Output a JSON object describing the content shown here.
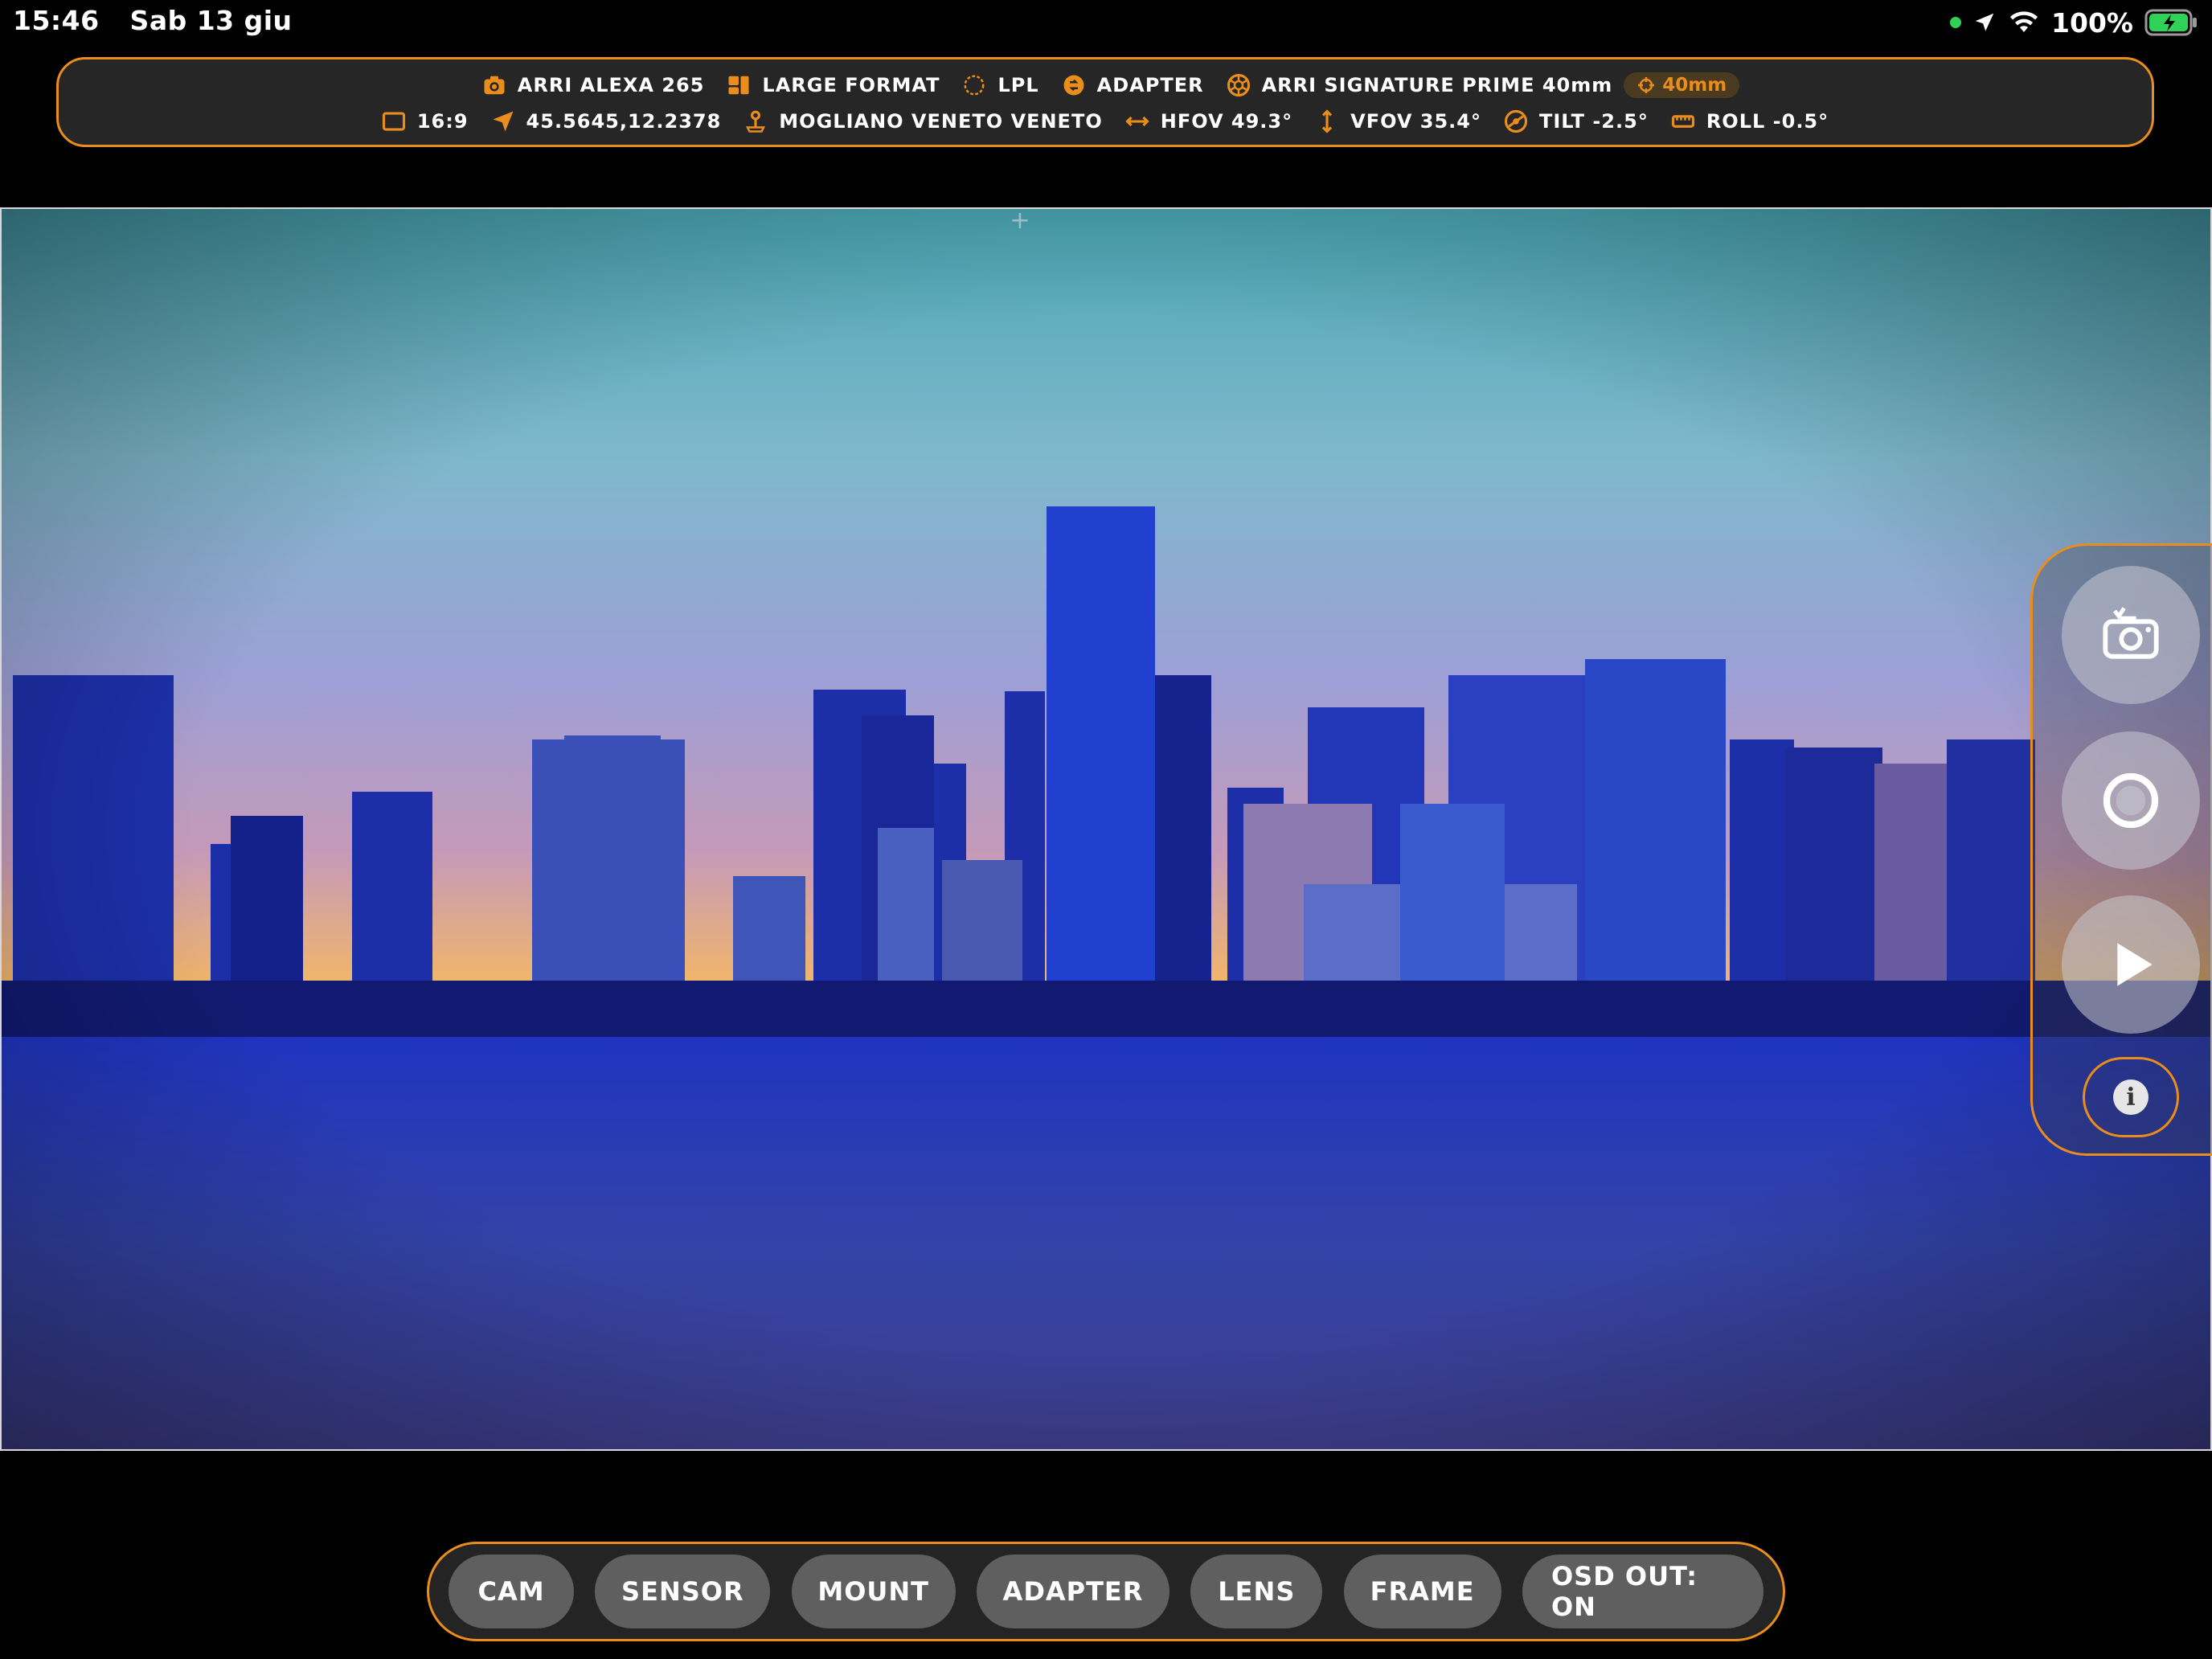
{
  "status_bar": {
    "time": "15:46",
    "date": "Sab 13 giu",
    "battery": "100%"
  },
  "info_bar": {
    "row1": [
      {
        "icon": "camera-icon",
        "label": "ARRI ALEXA 265"
      },
      {
        "icon": "sensor-icon",
        "label": "LARGE FORMAT"
      },
      {
        "icon": "mount-icon",
        "label": "LPL"
      },
      {
        "icon": "adapter-icon",
        "label": "ADAPTER"
      },
      {
        "icon": "lens-icon",
        "label": "ARRI SIGNATURE PRIME 40mm"
      }
    ],
    "focal_badge": "40mm",
    "row2": [
      {
        "icon": "frame-icon",
        "label": "16:9"
      },
      {
        "icon": "location-icon",
        "label": "45.5645,12.2378"
      },
      {
        "icon": "place-icon",
        "label": "MOGLIANO VENETO VENETO"
      },
      {
        "icon": "hfov-icon",
        "label": "HFOV 49.3°"
      },
      {
        "icon": "vfov-icon",
        "label": "VFOV 35.4°"
      },
      {
        "icon": "tilt-icon",
        "label": "TILT -2.5°"
      },
      {
        "icon": "roll-icon",
        "label": "ROLL -0.5°"
      }
    ]
  },
  "bottom_menu": {
    "cam": "CAM",
    "sensor": "SENSOR",
    "mount": "MOUNT",
    "adapter": "ADAPTER",
    "lens": "LENS",
    "frame": "FRAME",
    "osd": "OSD OUT: ON"
  },
  "colors": {
    "accent": "#e98d1c",
    "panel": "#262626",
    "button": "#5f5f5f"
  }
}
